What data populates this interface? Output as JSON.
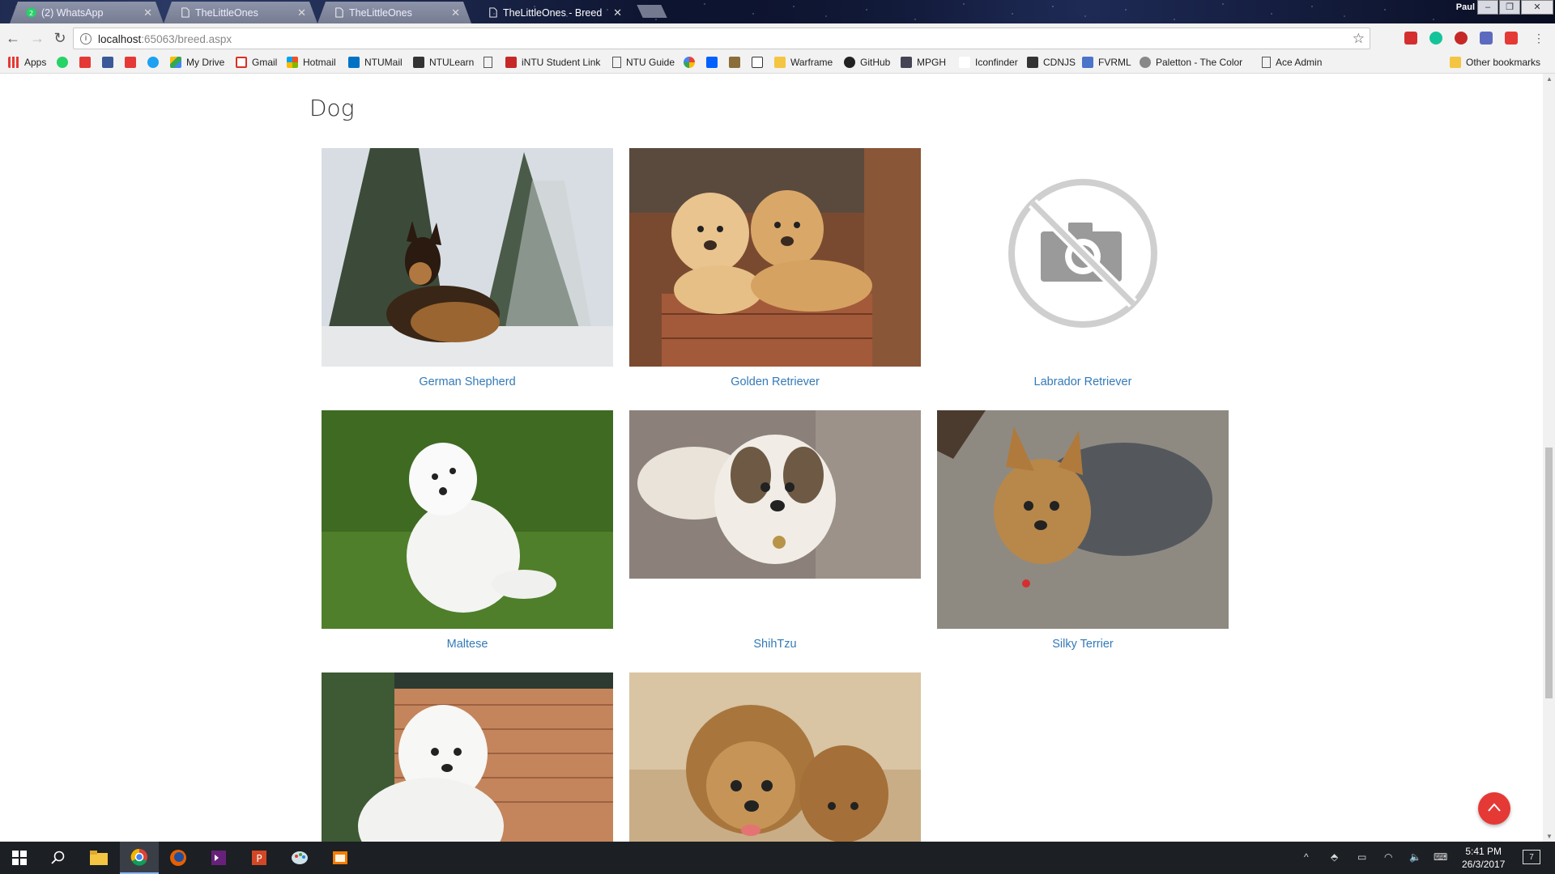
{
  "browser": {
    "tabs": [
      {
        "label": "(2) WhatsApp",
        "active": false
      },
      {
        "label": "TheLittleOnes",
        "active": false
      },
      {
        "label": "TheLittleOnes",
        "active": false
      },
      {
        "label": "TheLittleOnes - Breed",
        "active": true
      }
    ],
    "user_label": "Paul K",
    "url_host": "localhost",
    "url_path": ":65063/breed.aspx",
    "bookmarks": [
      "Apps",
      "My Drive",
      "Gmail",
      "Hotmail",
      "NTUMail",
      "NTULearn",
      "iNTU Student Link",
      "NTU Guide",
      "Warframe",
      "GitHub",
      "MPGH",
      "Iconfinder",
      "CDNJS",
      "FVRML",
      "Paletton - The Color S",
      "Ace Admin",
      "Other bookmarks"
    ]
  },
  "page": {
    "heading": "Dog",
    "breeds": [
      {
        "name": "German Shepherd"
      },
      {
        "name": "Golden Retriever"
      },
      {
        "name": "Labrador Retriever"
      },
      {
        "name": "Maltese"
      },
      {
        "name": "ShihTzu"
      },
      {
        "name": "Silky Terrier"
      },
      {
        "name": ""
      },
      {
        "name": ""
      }
    ],
    "colors": {
      "link": "#337ab7",
      "back_to_top": "#e53935"
    }
  },
  "taskbar": {
    "time": "5:41 PM",
    "date": "26/3/2017",
    "notifications": "7"
  }
}
